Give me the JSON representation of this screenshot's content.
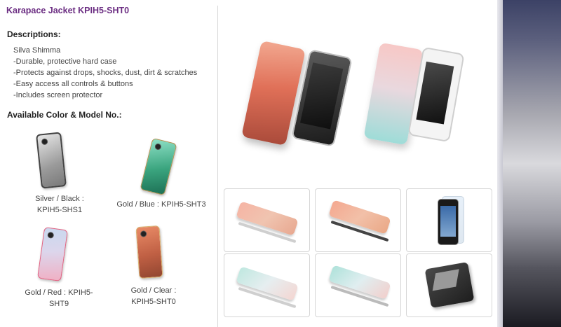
{
  "product": {
    "title": "Karapace Jacket KPIH5-SHT0"
  },
  "descriptions": {
    "heading": "Descriptions:",
    "items": [
      "Silva Shimma",
      "-Durable, protective hard case",
      "-Protects against drops, shocks, dust, dirt & scratches",
      "-Easy access all controls & buttons",
      "-Includes screen protector"
    ]
  },
  "available": {
    "heading": "Available Color & Model No.:",
    "models": [
      {
        "line1": "Silver / Black :",
        "line2": "KPIH5-SHS1",
        "color_top": "#d8d8d8",
        "color_bottom": "#8a8a8a"
      },
      {
        "line1": "Gold / Blue : KPIH5-SHT3",
        "line2": "",
        "color_top": "#7fd0b8",
        "color_bottom": "#2a8a6a"
      },
      {
        "line1": "Gold / Red : KPIH5-SHT9",
        "line2": "",
        "color_top": "#a9c8e0",
        "color_bottom": "#e89ab0"
      },
      {
        "line1": "Gold / Clear :",
        "line2": "KPIH5-SHT0",
        "color_top": "#e07a58",
        "color_bottom": "#a4563e"
      }
    ]
  },
  "gallery": {
    "thumbnails": [
      {
        "name": "thumb-coral-case-front"
      },
      {
        "name": "thumb-coral-case-angle"
      },
      {
        "name": "thumb-screen-protector"
      },
      {
        "name": "thumb-mint-case-front"
      },
      {
        "name": "thumb-mint-case-angle"
      },
      {
        "name": "thumb-leather-pouch"
      }
    ]
  }
}
